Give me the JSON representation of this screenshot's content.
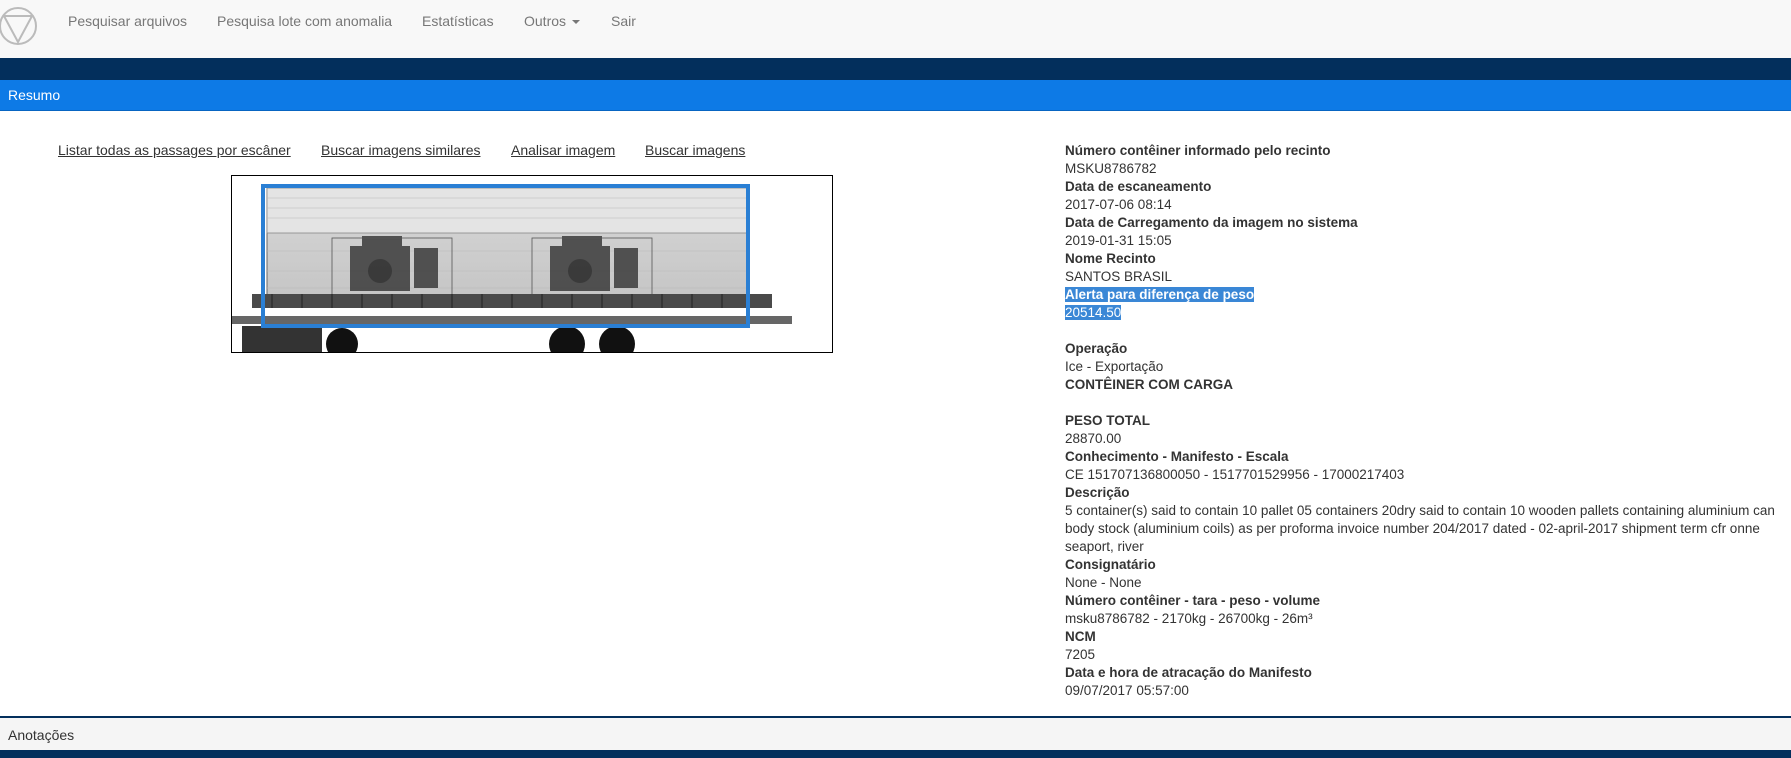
{
  "nav": {
    "items": [
      "Pesquisar arquivos",
      "Pesquisa lote com anomalia",
      "Estatísticas",
      "Outros",
      "Sair"
    ]
  },
  "summary": {
    "title": "Resumo"
  },
  "actions": [
    "Listar todas as passages por escâner",
    "Buscar imagens similares",
    "Analisar imagem",
    "Buscar imagens"
  ],
  "details": {
    "container_label": "Número contêiner informado pelo recinto",
    "container_value": "MSKU8786782",
    "scan_date_label": "Data de escaneamento",
    "scan_date_value": "2017-07-06 08:14",
    "upload_date_label": "Data de Carregamento da imagem no sistema",
    "upload_date_value": "2019-01-31 15:05",
    "facility_label": "Nome Recinto",
    "facility_value": "SANTOS BRASIL",
    "weight_alert_label": "Alerta para diferença de peso",
    "weight_alert_value": "20514.50",
    "operation_label": "Operação",
    "operation_value": "Ice - Exportação",
    "cargo_status": "CONTÊINER COM CARGA",
    "total_weight_label": "PESO TOTAL",
    "total_weight_value": "28870.00",
    "manifest_label": "Conhecimento - Manifesto - Escala",
    "manifest_value": "CE 151707136800050 - 1517701529956 - 17000217403",
    "description_label": "Descrição",
    "description_value": "5 container(s) said to contain 10 pallet 05 containers 20dry said to contain 10 wooden pallets containing aluminium can body stock (aluminium coils) as per proforma invoice number 204/2017 dated - 02-april-2017 shipment term cfr onne seaport, river",
    "consignee_label": "Consignatário",
    "consignee_value": "None - None",
    "container_details_label": "Número contêiner - tara - peso - volume",
    "container_details_value": "msku8786782 - 2170kg - 26700kg - 26m³",
    "ncm_label": "NCM",
    "ncm_value": "7205",
    "berthing_label": "Data e hora de atracação do Manifesto",
    "berthing_value": "09/07/2017 05:57:00"
  },
  "annotations": {
    "title": "Anotações"
  },
  "colors": {
    "navbar_bg": "#f8f8f8",
    "dark_band": "#032f5c",
    "summary_bar": "#0d7ae6",
    "highlight": "#3a87d6"
  }
}
